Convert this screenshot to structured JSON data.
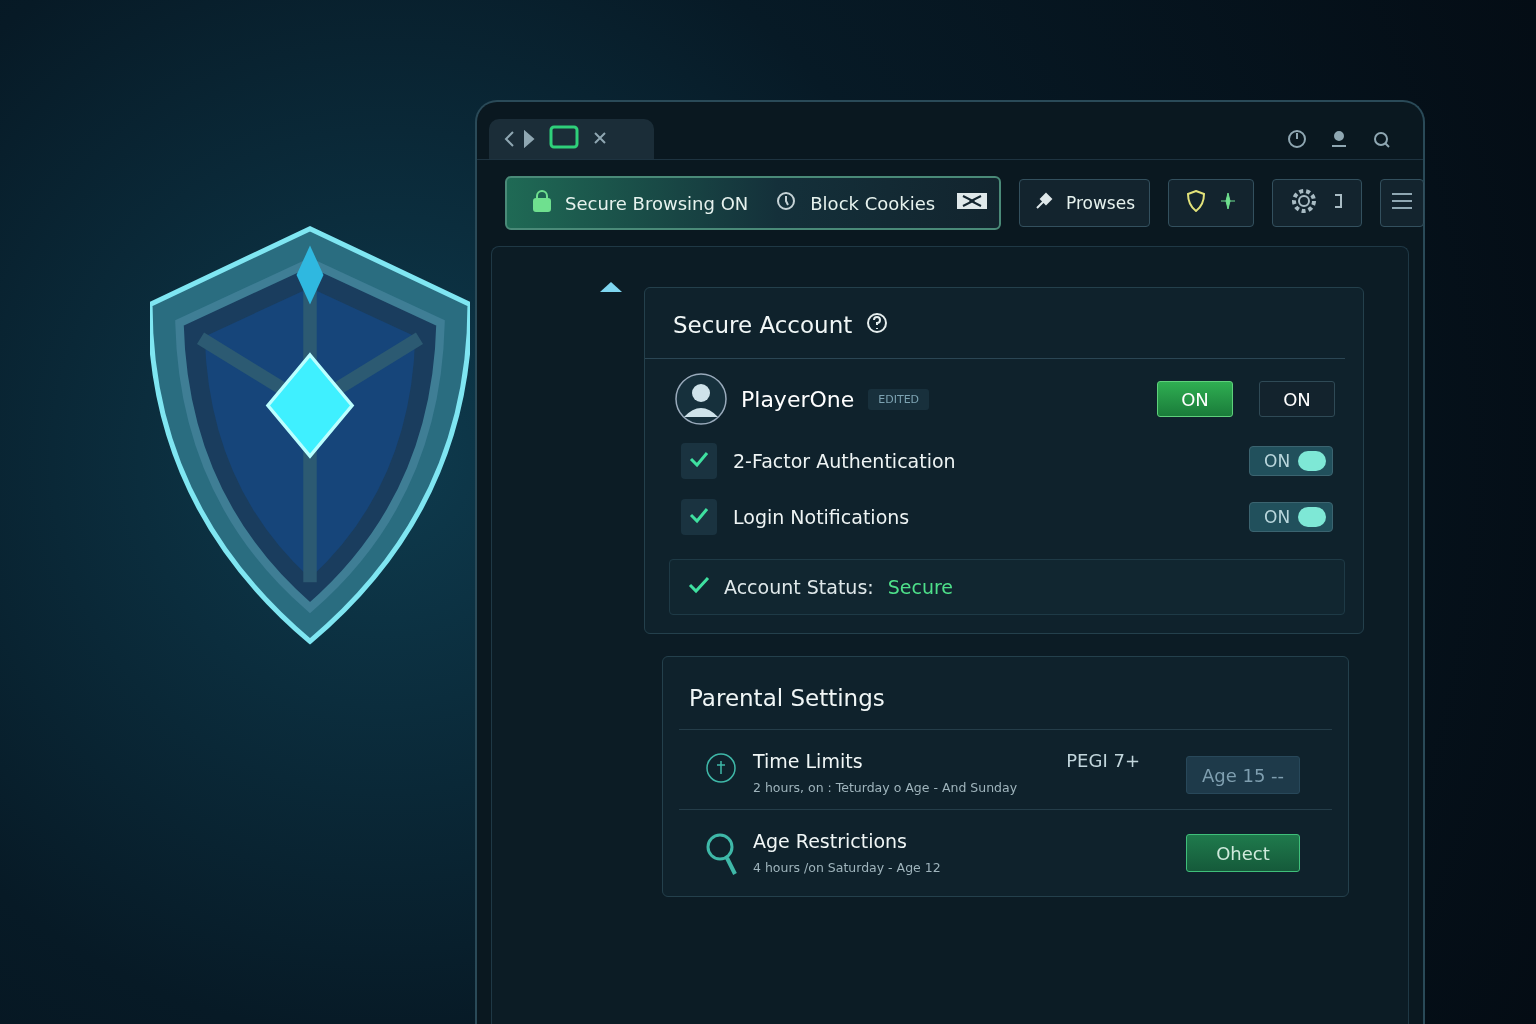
{
  "toolbar": {
    "secure_pill": {
      "label": "Secure Browsing ON",
      "on": true
    },
    "cookies": {
      "label": "Block Cookies"
    },
    "buttons": [
      {
        "label": "Prowses"
      }
    ]
  },
  "secure_account": {
    "title": "Secure Account",
    "user": {
      "name": "PlayerOne",
      "badge": "EDITED"
    },
    "mode_buttons": [
      {
        "label": "ON",
        "selected": true
      },
      {
        "label": "ON",
        "selected": false
      }
    ],
    "settings": [
      {
        "label": "2-Factor Authentication",
        "checked": true,
        "switch_label": "ON",
        "on": true
      },
      {
        "label": "Login Notifications",
        "checked": true,
        "switch_label": "ON",
        "on": true
      }
    ],
    "status": {
      "label": "Account Status:",
      "value": "Secure"
    }
  },
  "parental_settings": {
    "title": "Parental Settings",
    "rows": [
      {
        "kind": "time",
        "title": "Time Limits",
        "detail": "2 hours, on : Teturday o Age - And Sunday",
        "rating": "PEGI 7+",
        "action": {
          "label": "Age 15 --",
          "disabled": true
        }
      },
      {
        "kind": "search",
        "title": "Age Restrictions",
        "detail": "4 hours /on Saturday - Age 12",
        "action": {
          "label": "Ohect",
          "disabled": false
        }
      }
    ]
  }
}
